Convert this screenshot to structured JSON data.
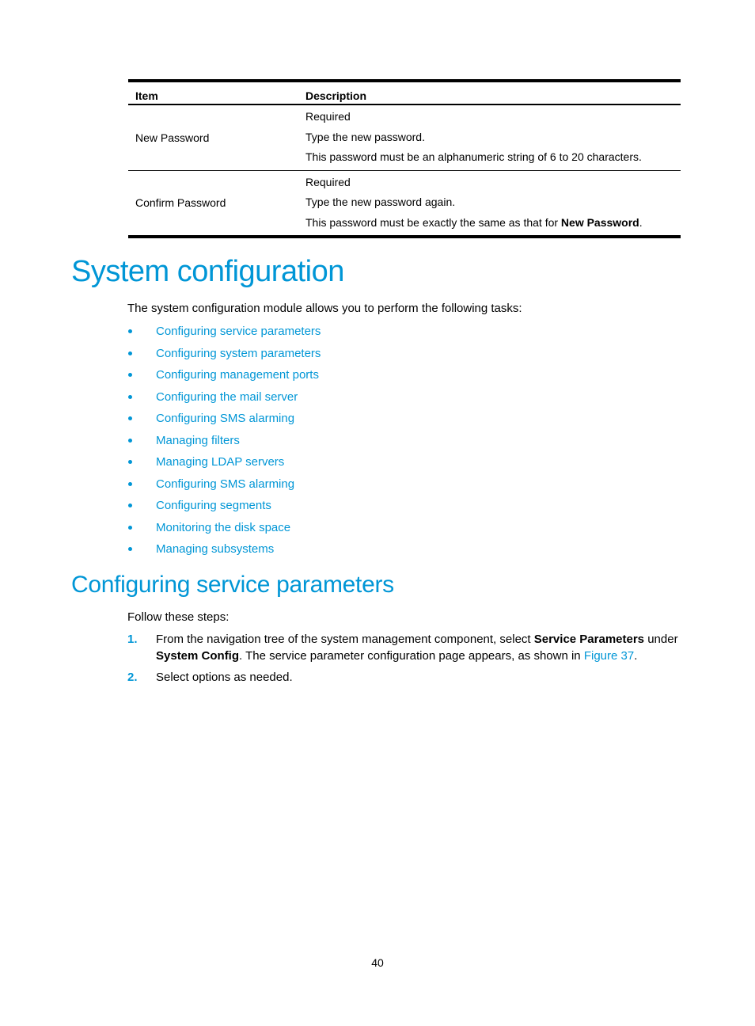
{
  "table": {
    "headers": [
      "Item",
      "Description"
    ],
    "rows": [
      {
        "item": "New Password",
        "lines": [
          "Required",
          "Type the new password.",
          "This password must be an alphanumeric string of 6 to 20 characters."
        ]
      },
      {
        "item": "Confirm Password",
        "lines": [
          "Required",
          "Type the new password again."
        ],
        "last_line_prefix": "This password must be exactly the same as that for ",
        "last_line_bold": "New Password",
        "last_line_suffix": "."
      }
    ]
  },
  "section1": {
    "title": "System configuration",
    "intro": "The system configuration module allows you to perform the following tasks:",
    "links": [
      "Configuring service parameters",
      "Configuring system parameters",
      "Configuring management ports",
      "Configuring the mail server",
      "Configuring SMS alarming",
      "Managing filters",
      "Managing LDAP servers",
      "Configuring SMS alarming",
      "Configuring segments",
      "Monitoring the disk space",
      "Managing subsystems"
    ]
  },
  "section2": {
    "title": "Configuring service parameters",
    "intro": "Follow these steps:",
    "steps": [
      {
        "num": "1.",
        "t1": "From the navigation tree of the system management component, select ",
        "b1": "Service Parameters",
        "t2": " under ",
        "b2": "System Config",
        "t3": ". The service parameter configuration page appears, as shown in ",
        "link": "Figure 37",
        "t4": "."
      },
      {
        "num": "2.",
        "t1": "Select options as needed."
      }
    ]
  },
  "page_number": "40",
  "colors": {
    "accent": "#0096d6"
  }
}
